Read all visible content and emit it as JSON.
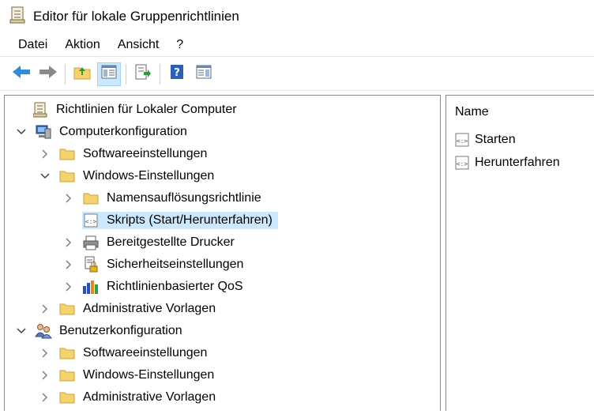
{
  "window": {
    "title": "Editor für lokale Gruppenrichtlinien",
    "icon": "policy-editor-icon"
  },
  "menu": [
    "Datei",
    "Aktion",
    "Ansicht",
    "?"
  ],
  "toolbar": {
    "buttons": [
      "back-arrow-icon",
      "forward-arrow-icon",
      "up-folder-icon",
      "show-hide-tree-icon",
      "export-list-icon",
      "help-icon",
      "properties-view-icon"
    ]
  },
  "tree": {
    "root": "Richtlinien für Lokaler Computer",
    "computer": {
      "label": "Computerkonfiguration",
      "software": "Softwareeinstellungen",
      "windows": "Windows-Einstellungen",
      "name_resolution": "Namensauflösungsrichtlinie",
      "scripts": "Skripts (Start/Herunterfahren)",
      "printers": "Bereitgestellte Drucker",
      "security": "Sicherheitseinstellungen",
      "qos": "Richtlinienbasierter QoS",
      "admin_templates": "Administrative Vorlagen"
    },
    "user": {
      "label": "Benutzerkonfiguration",
      "software": "Softwareeinstellungen",
      "windows": "Windows-Einstellungen",
      "admin_templates": "Administrative Vorlagen"
    }
  },
  "details": {
    "column_name": "Name",
    "items": [
      "Starten",
      "Herunterfahren"
    ]
  },
  "colors": {
    "selection": "#cce8ff",
    "folder": "#f5d26b",
    "arrow": "#2e8bde"
  }
}
